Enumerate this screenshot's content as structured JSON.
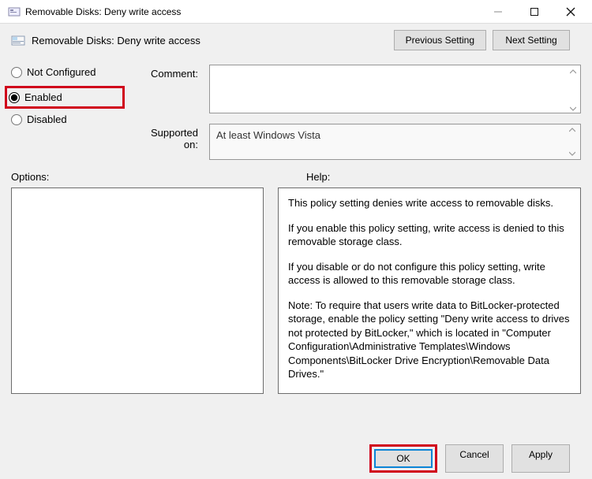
{
  "titlebar": {
    "icon": "policy-icon",
    "title": "Removable Disks: Deny write access"
  },
  "header": {
    "policyTitle": "Removable Disks: Deny write access"
  },
  "navButtons": {
    "previous": "Previous Setting",
    "next": "Next Setting"
  },
  "radios": {
    "notConfigured": "Not Configured",
    "enabled": "Enabled",
    "disabled": "Disabled",
    "selected": "enabled"
  },
  "labels": {
    "comment": "Comment:",
    "supportedOn": "Supported on:",
    "options": "Options:",
    "help": "Help:"
  },
  "comment": "",
  "supportedOn": "At least Windows Vista",
  "help": {
    "p1": "This policy setting denies write access to removable disks.",
    "p2": "If you enable this policy setting, write access is denied to this removable storage class.",
    "p3": "If you disable or do not configure this policy setting, write access is allowed to this removable storage class.",
    "p4": "Note: To require that users write data to BitLocker-protected storage, enable the policy setting \"Deny write access to drives not protected by BitLocker,\" which is located in \"Computer Configuration\\Administrative Templates\\Windows Components\\BitLocker Drive Encryption\\Removable Data Drives.\""
  },
  "footer": {
    "ok": "OK",
    "cancel": "Cancel",
    "apply": "Apply"
  }
}
